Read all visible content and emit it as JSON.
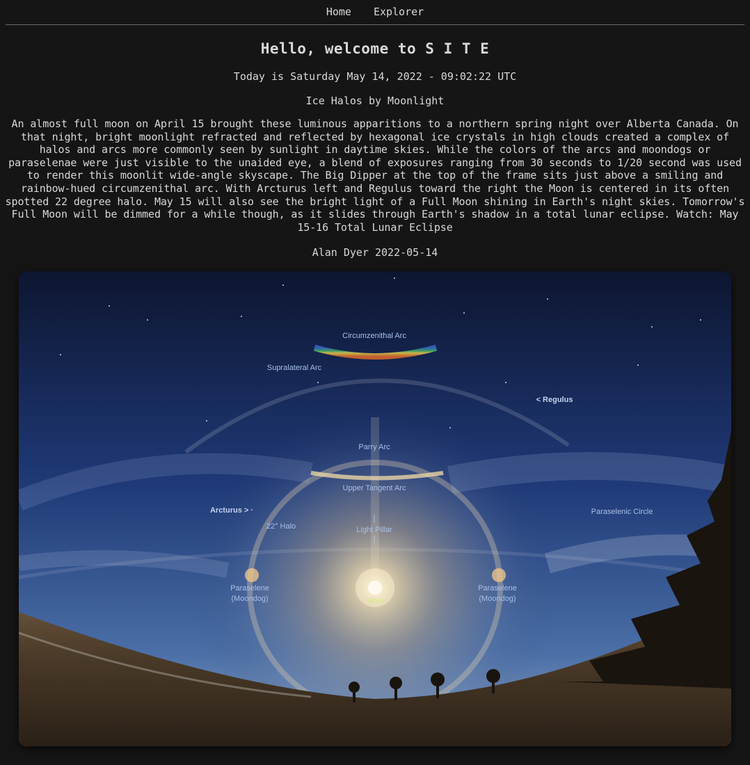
{
  "nav": {
    "home_label": "Home",
    "explorer_label": "Explorer"
  },
  "header": {
    "title": "Hello, welcome to S I T E",
    "date_line": "Today is Saturday May 14, 2022 - 09:02:22 UTC"
  },
  "apod": {
    "title": "Ice Halos by Moonlight",
    "explanation": "An almost full moon on April 15 brought these luminous apparitions to a northern spring night over Alberta Canada. On that night, bright moonlight refracted and reflected by hexagonal ice crystals in high clouds created a complex of halos and arcs more commonly seen by sunlight in daytime skies. While the colors of the arcs and moondogs or paraselenae were just visible to the unaided eye, a blend of exposures ranging from 30 seconds to 1/20 second was used to render this moonlit wide-angle skyscape. The Big Dipper at the top of the frame sits just above a smiling and rainbow-hued circumzenithal arc. With Arcturus left and Regulus toward the right the Moon is centered in its often spotted 22 degree halo. May 15 will also see the bright light of a Full Moon shining in Earth's night skies. Tomorrow's Full Moon will be dimmed for a while though, as it slides through Earth's shadow in a total lunar eclipse. Watch: May 15-16 Total Lunar Eclipse",
    "credit": "Alan Dyer 2022-05-14"
  },
  "image_labels": {
    "circumzenithal_arc": "Circumzenithal Arc",
    "supralateral_arc": "Supralateral Arc",
    "regulus": "< Regulus",
    "parry_arc": "Parry Arc",
    "upper_tangent_arc": "Upper Tangent Arc",
    "arcturus": "Arcturus > ·",
    "halo_22": "22° Halo",
    "light_pillar": "Light Pillar",
    "paraselenic_circle": "Paraselenic Circle",
    "paraselene_left_1": "Paraselene",
    "paraselene_left_2": "(Moondog)",
    "paraselene_right_1": "Paraselene",
    "paraselene_right_2": "(Moondog)",
    "moon": "Moon"
  }
}
